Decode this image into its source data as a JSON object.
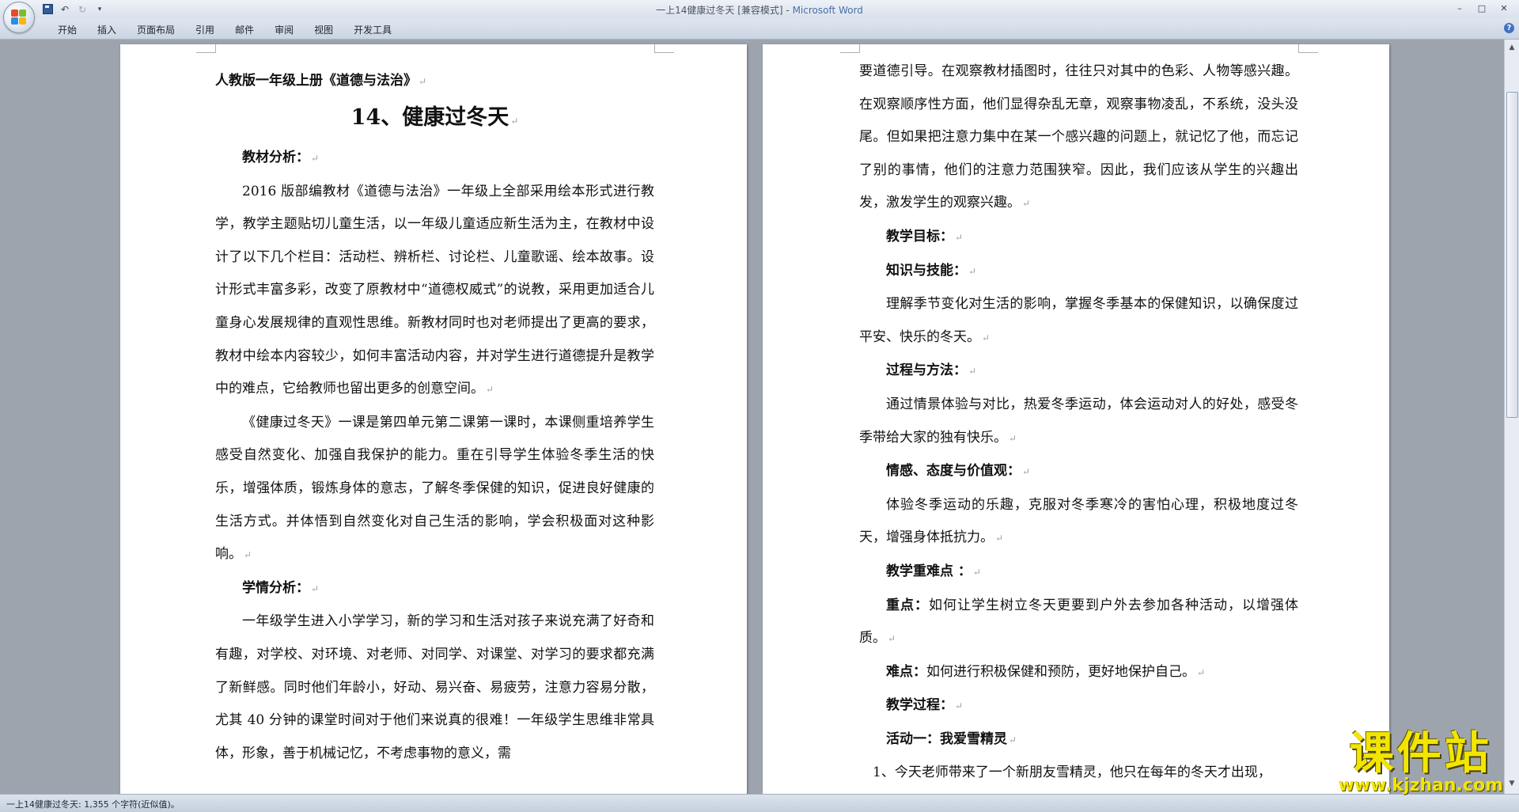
{
  "window": {
    "title_doc": "一上14健康过冬天 [兼容模式]",
    "title_sep": " - ",
    "title_app": "Microsoft Word",
    "controls": {
      "minimize": "–",
      "maximize": "□",
      "close": "✕"
    }
  },
  "quick_access": {
    "undo": "↶",
    "redo": "↻",
    "more": "▾"
  },
  "ribbon": {
    "tabs": [
      "开始",
      "插入",
      "页面布局",
      "引用",
      "邮件",
      "审阅",
      "视图",
      "开发工具"
    ],
    "help": "?"
  },
  "colors": {
    "accent": "#4a6ea8",
    "background": "#9ea4ae",
    "watermark": "#f2e600"
  },
  "icons": [
    "office-button-icon",
    "save-icon",
    "undo-icon",
    "redo-icon",
    "customize-icon",
    "help-icon",
    "minimize-icon",
    "maximize-icon",
    "close-icon"
  ],
  "document": {
    "left_page": {
      "subject": "人教版一年级上册《道德与法治》",
      "title": "14、健康过冬天",
      "sec1_heading": "教材分析：",
      "sec1_p1": "2016 版部编教材《道德与法治》一年级上全部采用绘本形式进行教学，教学主题贴切儿童生活，以一年级儿童适应新生活为主，在教材中设计了以下几个栏目：活动栏、辨析栏、讨论栏、儿童歌谣、绘本故事。设计形式丰富多彩，改变了原教材中“道德权威式”的说教，采用更加适合儿童身心发展规律的直观性思维。新教材同时也对老师提出了更高的要求，教材中绘本内容较少，如何丰富活动内容，并对学生进行道德提升是教学中的难点，它给教师也留出更多的创意空间。",
      "sec1_p2": "《健康过冬天》一课是第四单元第二课第一课时，本课侧重培养学生感受自然变化、加强自我保护的能力。重在引导学生体验冬季生活的快乐，增强体质，锻炼身体的意志，了解冬季保健的知识，促进良好健康的生活方式。并体悟到自然变化对自己生活的影响，学会积极面对这种影响。",
      "sec2_heading": "学情分析：",
      "sec2_p1": "一年级学生进入小学学习，新的学习和生活对孩子来说充满了好奇和有趣，对学校、对环境、对老师、对同学、对课堂、对学习的要求都充满了新鲜感。同时他们年龄小，好动、易兴奋、易疲劳，注意力容易分散，尤其 40 分钟的课堂时间对于他们来说真的很难！一年级学生思维非常具体，形象，善于机械记忆，不考虑事物的意义，需"
    },
    "right_page": {
      "cont_p": "要道德引导。在观察教材插图时，往往只对其中的色彩、人物等感兴趣。在观察顺序性方面，他们显得杂乱无章，观察事物凌乱，不系统，没头没尾。但如果把注意力集中在某一个感兴趣的问题上，就记忆了他，而忘记了别的事情，他们的注意力范围狭窄。因此，我们应该从学生的兴趣出发，激发学生的观察兴趣。",
      "goal_heading": "教学目标：",
      "knowledge_heading": "知识与技能：",
      "knowledge_p": "理解季节变化对生活的影响，掌握冬季基本的保健知识，以确保度过平安、快乐的冬天。",
      "process_heading": "过程与方法：",
      "process_p": "通过情景体验与对比，热爱冬季运动，体会运动对人的好处，感受冬季带给大家的独有快乐。",
      "emotion_heading": "情感、态度与价值观：",
      "emotion_p": "体验冬季运动的乐趣，克服对冬季寒冷的害怕心理，积极地度过冬天，增强身体抵抗力。",
      "keypoint_heading": "教学重难点 ：",
      "focus_label": "重点：",
      "focus_text": "如何让学生树立冬天更要到户外去参加各种活动，以增强体质。",
      "difficulty_label": "难点：",
      "difficulty_text": "如何进行积极保健和预防，更好地保护自己。",
      "procedure_heading": "教学过程：",
      "activity1_heading": "活动一：我爱雪精灵",
      "activity1_p": "1、今天老师带来了一个新朋友雪精灵，他只在每年的冬天才出现，"
    },
    "para_mark": "↵"
  },
  "statusbar": {
    "text": "一上14健康过冬天: 1,355 个字符(近似值)。"
  },
  "watermark": {
    "main": "课件站",
    "sub": "www.kjzhan.com"
  }
}
